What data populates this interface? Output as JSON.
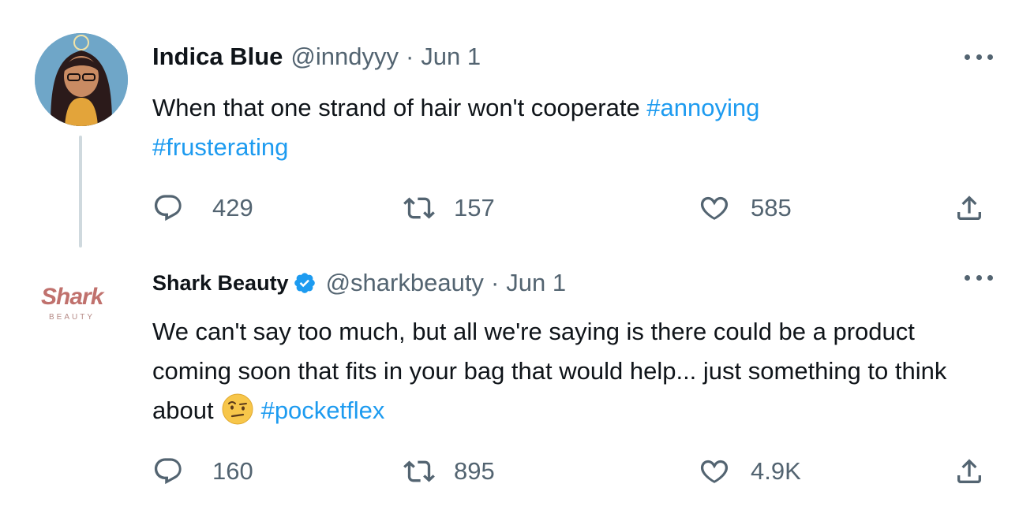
{
  "tweets": [
    {
      "display_name": "Indica Blue",
      "handle": "@inndyyy",
      "separator": "·",
      "date": "Jun 1",
      "text_plain": "When that one strand of hair won't cooperate ",
      "hashtags": [
        "#annoying",
        "#frusterating"
      ],
      "counts": {
        "replies": "429",
        "retweets": "157",
        "likes": "585"
      }
    },
    {
      "display_name": "Shark Beauty",
      "verified": true,
      "handle": "@sharkbeauty",
      "separator": "·",
      "date": "Jun 1",
      "avatar_logo": {
        "brand": "Shark",
        "sub": "BEAUTY"
      },
      "text_plain": "We can't say too much, but all we're saying is there could be a product coming soon that fits in your bag that would help... just something to think about",
      "emoji": "face-with-raised-eyebrow",
      "hashtags": [
        "#pocketflex"
      ],
      "counts": {
        "replies": "160",
        "retweets": "895",
        "likes": "4.9K"
      }
    }
  ],
  "colors": {
    "hashtag": "#1d9bf0",
    "muted": "#536471",
    "text": "#0f1419",
    "verified": "#1d9bf0",
    "thread_line": "#cfd9de",
    "shark_logo": "#c0716d"
  },
  "icons": [
    "more-icon",
    "reply-icon",
    "retweet-icon",
    "like-icon",
    "share-icon",
    "verified-badge-icon"
  ]
}
